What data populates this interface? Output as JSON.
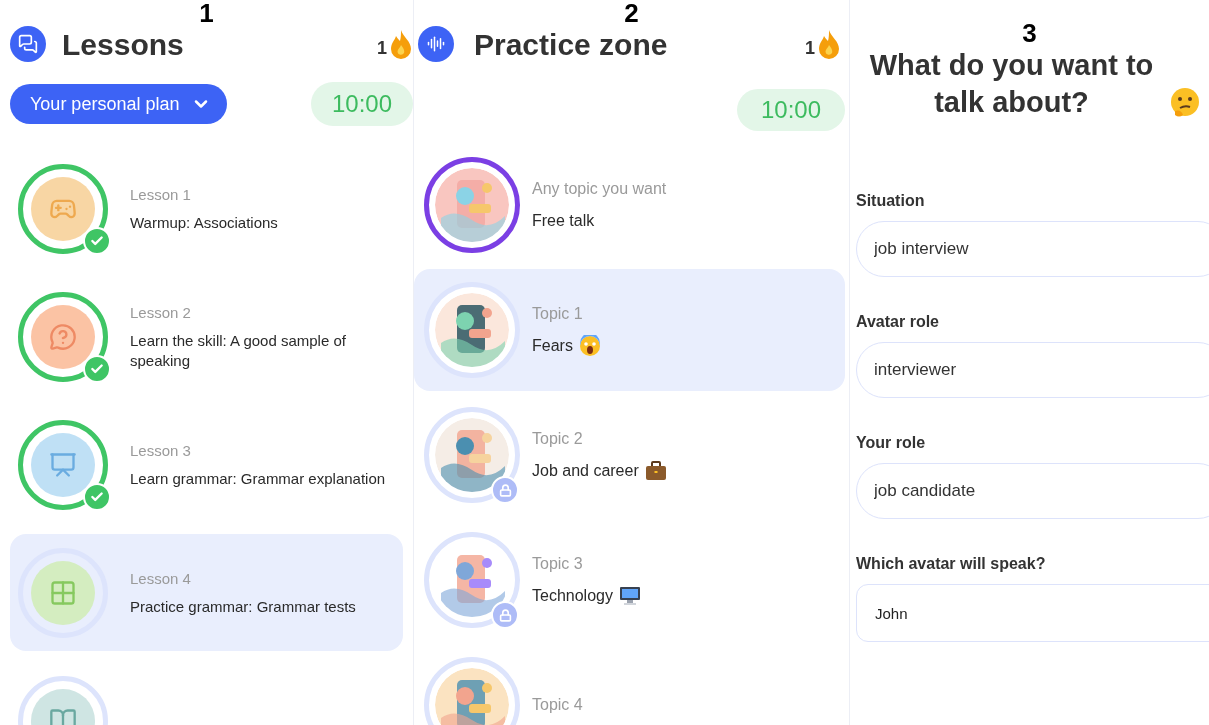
{
  "lessons_panel": {
    "number": "1",
    "title": "Lessons",
    "streak": "1",
    "plan_button": "Your personal plan",
    "timer": "10:00",
    "items": [
      {
        "label": "Lesson 1",
        "title": "Warmup: Associations",
        "completed": true,
        "selected": false,
        "color": "#f8d6a4"
      },
      {
        "label": "Lesson 2",
        "title": "Learn the skill: A good sample of speaking",
        "completed": true,
        "selected": false,
        "color": "#fbc3a4"
      },
      {
        "label": "Lesson 3",
        "title": "Learn grammar: Grammar explanation",
        "completed": true,
        "selected": false,
        "color": "#bfe0f5"
      },
      {
        "label": "Lesson 4",
        "title": "Practice grammar: Grammar tests",
        "completed": false,
        "selected": true,
        "color": "#d4edc0"
      },
      {
        "completed": false,
        "selected": false,
        "color": "#cfe5e3"
      }
    ]
  },
  "practice_panel": {
    "number": "2",
    "title": "Practice zone",
    "streak": "1",
    "timer": "10:00",
    "items": [
      {
        "kind": "free",
        "label": "Any topic you want",
        "title": "Free talk",
        "locked": false,
        "selected": false
      },
      {
        "kind": "topic",
        "label": "Topic 1",
        "title": "Fears",
        "locked": false,
        "selected": true
      },
      {
        "kind": "topic",
        "label": "Topic 2",
        "title": "Job and career",
        "locked": true,
        "selected": false
      },
      {
        "kind": "topic",
        "label": "Topic 3",
        "title": "Technology",
        "locked": true,
        "selected": false
      },
      {
        "kind": "topic",
        "label": "Topic 4",
        "selected": false
      }
    ]
  },
  "talk_panel": {
    "number": "3",
    "title": "What do you want to talk about?",
    "fields": [
      {
        "kind": "text",
        "label": "Situation",
        "value": "job interview"
      },
      {
        "kind": "text",
        "label": "Avatar role",
        "value": "interviewer"
      },
      {
        "kind": "text",
        "label": "Your role",
        "value": "job candidate"
      },
      {
        "kind": "select",
        "label": "Which avatar will speak?",
        "value": "John"
      }
    ]
  }
}
